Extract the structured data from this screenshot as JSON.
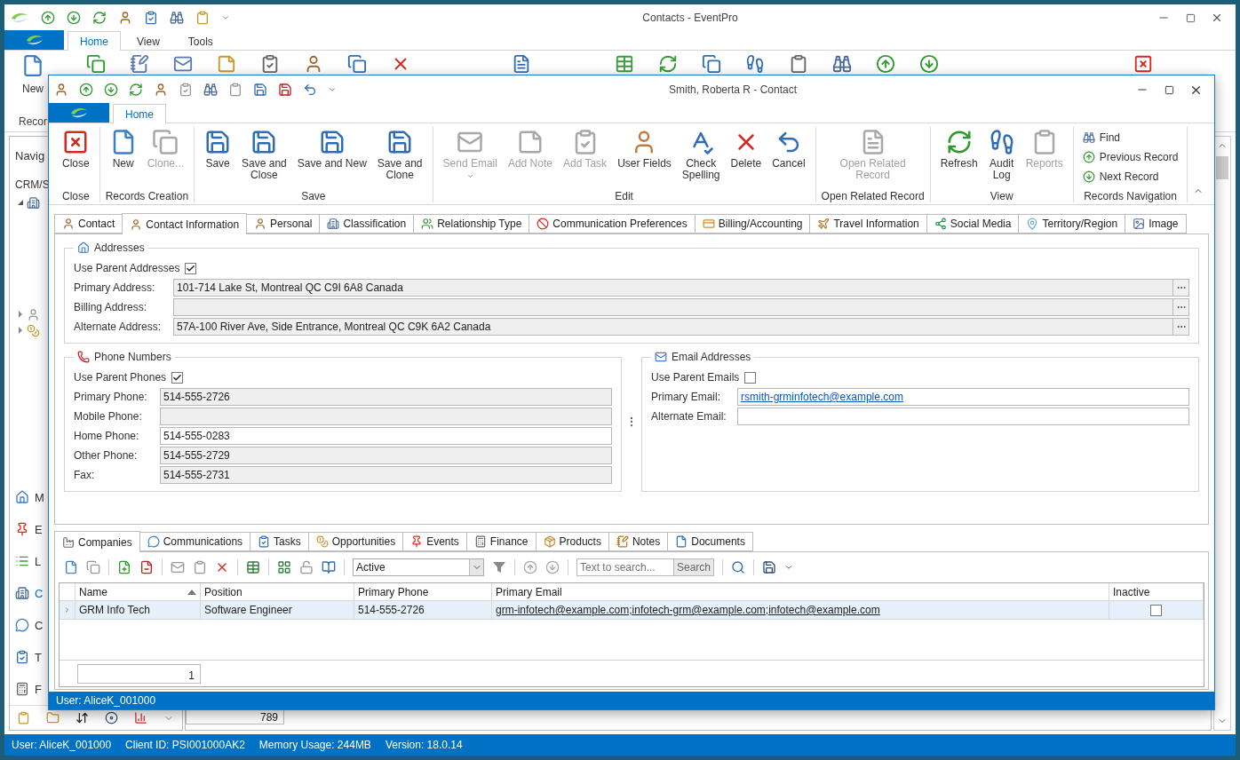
{
  "main_window": {
    "title": "Contacts - EventPro",
    "ribbon_tabs": [
      {
        "label": "Home",
        "selected": true
      },
      {
        "label": "View",
        "selected": false
      },
      {
        "label": "Tools",
        "selected": false
      }
    ],
    "ribbon_button": "New",
    "ribbon_group": "Recor",
    "nav_title": "Navig",
    "nav_section": "CRM/S",
    "nav_tree": [
      {
        "expanded": true
      },
      {
        "expanded": false
      },
      {
        "expanded": false
      }
    ],
    "nav_items": [
      {
        "label": "M",
        "selected": false
      },
      {
        "label": "E",
        "selected": false
      },
      {
        "label": "L",
        "selected": false
      },
      {
        "label": "C",
        "selected": true
      },
      {
        "label": "C",
        "selected": false
      },
      {
        "label": "T",
        "selected": false
      },
      {
        "label": "F",
        "selected": false
      }
    ],
    "summary_value": "789",
    "status_bar": [
      "User: AliceK_001000",
      "Client ID: PSI001000AK2",
      "Memory Usage: 244MB",
      "Version: 18.0.14"
    ]
  },
  "dialog": {
    "title": "Smith, Roberta R - Contact",
    "ribbon_tabs": [
      {
        "label": "Home",
        "selected": true
      }
    ],
    "ribbon_groups": [
      {
        "label": "Close",
        "kind": "large",
        "buttons": [
          {
            "label": "Close",
            "disabled": false
          }
        ]
      },
      {
        "label": "Records Creation",
        "kind": "large",
        "buttons": [
          {
            "label": "New",
            "disabled": false
          },
          {
            "label": "Clone...",
            "disabled": true
          }
        ]
      },
      {
        "label": "Save",
        "kind": "large",
        "buttons": [
          {
            "label": "Save",
            "disabled": false
          },
          {
            "label": "Save and\nClose",
            "disabled": false
          },
          {
            "label": "Save and New",
            "disabled": false
          },
          {
            "label": "Save and\nClone",
            "disabled": false
          }
        ]
      },
      {
        "label": "Edit",
        "kind": "large",
        "buttons": [
          {
            "label": "Send Email",
            "disabled": true,
            "dropdown": true
          },
          {
            "label": "Add Note",
            "disabled": true
          },
          {
            "label": "Add Task",
            "disabled": true
          },
          {
            "label": "User Fields",
            "disabled": false
          },
          {
            "label": "Check\nSpelling",
            "disabled": false
          },
          {
            "label": "Delete",
            "disabled": false
          },
          {
            "label": "Cancel",
            "disabled": false
          }
        ]
      },
      {
        "label": "Open Related Record",
        "kind": "large",
        "buttons": [
          {
            "label": "Open Related\nRecord",
            "disabled": true
          }
        ]
      },
      {
        "label": "View",
        "kind": "large",
        "buttons": [
          {
            "label": "Refresh",
            "disabled": false
          },
          {
            "label": "Audit\nLog",
            "disabled": false
          },
          {
            "label": "Reports",
            "disabled": true
          }
        ]
      },
      {
        "label": "Records Navigation",
        "kind": "small",
        "buttons": [
          {
            "label": "Find",
            "disabled": false
          },
          {
            "label": "Previous Record",
            "disabled": false
          },
          {
            "label": "Next Record",
            "disabled": false
          }
        ]
      }
    ],
    "form_tabs": [
      {
        "label": "Contact",
        "selected": false
      },
      {
        "label": "Contact Information",
        "selected": true
      },
      {
        "label": "Personal",
        "selected": false
      },
      {
        "label": "Classification",
        "selected": false
      },
      {
        "label": "Relationship Type",
        "selected": false
      },
      {
        "label": "Communication Preferences",
        "selected": false
      },
      {
        "label": "Billing/Accounting",
        "selected": false
      },
      {
        "label": "Travel Information",
        "selected": false
      },
      {
        "label": "Social Media",
        "selected": false
      },
      {
        "label": "Territory/Region",
        "selected": false
      },
      {
        "label": "Image",
        "selected": false
      }
    ],
    "groups": [
      {
        "kind": "address",
        "title": "Addresses",
        "checkbox": {
          "label": "Use Parent Addresses",
          "checked": true
        },
        "fields": [
          {
            "label": "Primary Address:",
            "value": "101-714 Lake St, Montreal QC C9I 6A8 Canada",
            "readonly": true
          },
          {
            "label": "Billing Address:",
            "readonly": true
          },
          {
            "label": "Alternate Address:",
            "value": "57A-100 River Ave, Side Entrance, Montreal QC C9K 6A2 Canada",
            "readonly": true
          }
        ]
      },
      {
        "kind": "phone",
        "title": "Phone Numbers",
        "checkbox": {
          "label": "Use Parent Phones",
          "checked": true
        },
        "fields": [
          {
            "label": "Primary Phone:",
            "value": "514-555-2726",
            "readonly": true
          },
          {
            "label": "Mobile Phone:",
            "readonly": true
          },
          {
            "label": "Home Phone:",
            "value": "514-555-0283",
            "readonly": false
          },
          {
            "label": "Other Phone:",
            "value": "514-555-2729",
            "readonly": true
          },
          {
            "label": "Fax:",
            "value": "514-555-2731",
            "readonly": true
          }
        ]
      },
      {
        "kind": "email",
        "title": "Email Addresses",
        "checkbox": {
          "label": "Use Parent Emails",
          "checked": false
        },
        "fields": [
          {
            "label": "Primary Email:",
            "value": "rsmith-grminfotech@example.com",
            "readonly": false
          },
          {
            "label": "Alternate Email:",
            "readonly": false
          }
        ]
      }
    ],
    "bottom_tabs": [
      {
        "label": "Companies",
        "selected": true
      },
      {
        "label": "Communications",
        "selected": false
      },
      {
        "label": "Tasks",
        "selected": false
      },
      {
        "label": "Opportunities",
        "selected": false
      },
      {
        "label": "Events",
        "selected": false
      },
      {
        "label": "Finance",
        "selected": false
      },
      {
        "label": "Products",
        "selected": false
      },
      {
        "label": "Notes",
        "selected": false
      },
      {
        "label": "Documents",
        "selected": false
      }
    ],
    "toolbar": {
      "filter_value": "Active",
      "search_placeholder": "Text to search...",
      "search_button": "Search"
    },
    "grid": {
      "columns": [
        {
          "label": "Name",
          "kind": "text",
          "sorted": true
        },
        {
          "label": "Position",
          "kind": "text",
          "sorted": false
        },
        {
          "label": "Primary Phone",
          "kind": "text",
          "sorted": false
        },
        {
          "label": "Primary Email",
          "kind": "link",
          "sorted": false
        },
        {
          "label": "Inactive",
          "kind": "check",
          "sorted": false
        }
      ],
      "rows": [
        {
          "selected": true,
          "cells": [
            "GRM Info Tech",
            "Software Engineer",
            "514-555-2726",
            "grm-infotech@example.com;infotech-grm@example.com;infotech@example.com",
            false
          ]
        }
      ],
      "footer": "1"
    },
    "status_bar": "User: AliceK_001000"
  }
}
